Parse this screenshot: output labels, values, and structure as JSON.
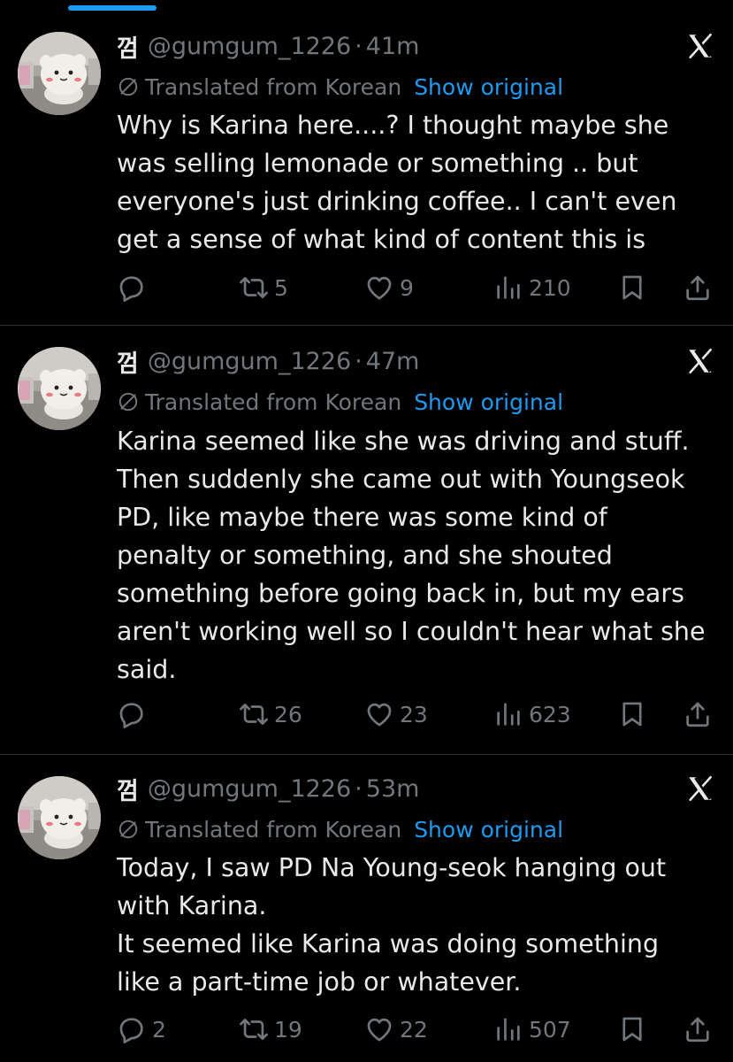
{
  "tweets": [
    {
      "display_name": "껌",
      "handle": "@gumgum_1226",
      "separator": "·",
      "time": "41m",
      "translated_label": "Translated from Korean",
      "show_original": "Show original",
      "text_lines": [
        "Why is Karina here....? I thought maybe she",
        "was selling lemonade or something .. but",
        "everyone's just drinking coffee.. I can't even",
        "get a sense of what kind of content this is"
      ],
      "replies": "",
      "retweets": "5",
      "likes": "9",
      "views": "210"
    },
    {
      "display_name": "껌",
      "handle": "@gumgum_1226",
      "separator": "·",
      "time": "47m",
      "translated_label": "Translated from Korean",
      "show_original": "Show original",
      "text_lines": [
        "Karina seemed like she was driving and stuff.",
        "Then suddenly she came out with Youngseok",
        "PD, like maybe there was some kind of",
        "penalty or something, and she shouted",
        "something before going back in, but my ears",
        "aren't working well so I couldn't hear what she",
        "said."
      ],
      "replies": "",
      "retweets": "26",
      "likes": "23",
      "views": "623"
    },
    {
      "display_name": "껌",
      "handle": "@gumgum_1226",
      "separator": "·",
      "time": "53m",
      "translated_label": "Translated from Korean",
      "show_original": "Show original",
      "text_lines": [
        "Today, I saw PD Na Young-seok hanging out",
        "with Karina.",
        "It seemed like Karina was doing something",
        "like a part-time job or whatever."
      ],
      "replies": "2",
      "retweets": "19",
      "likes": "22",
      "views": "507"
    }
  ],
  "icons": {
    "reply": "reply-icon",
    "retweet": "retweet-icon",
    "like": "heart-icon",
    "views": "views-icon",
    "bookmark": "bookmark-icon",
    "share": "share-icon",
    "translate": "translate-icon",
    "logo": "x-logo-icon"
  },
  "colors": {
    "background": "#000000",
    "text": "#e7e9ea",
    "secondary": "#71767b",
    "link": "#1d9bf0",
    "divider": "#2f3336"
  }
}
